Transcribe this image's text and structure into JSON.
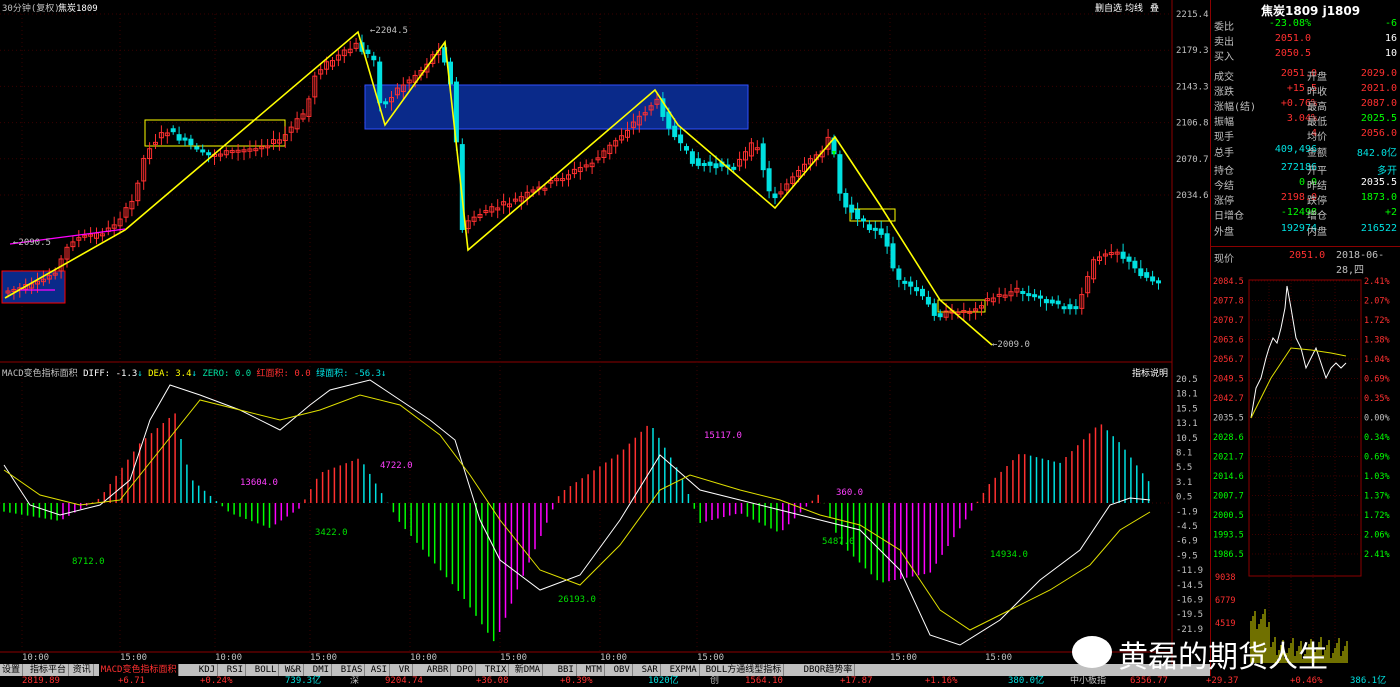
{
  "chart_header": {
    "period": "30分钟(复权)",
    "symbol": "焦炭1809"
  },
  "top_right_controls": [
    "删自选",
    "均线",
    "叠"
  ],
  "price_axis": [
    "2215.4",
    "2179.3",
    "2143.3",
    "2106.8",
    "2070.7",
    "2034.6"
  ],
  "price_annotations": {
    "high": "2204.5",
    "left": "2090.5",
    "low": "2009.0"
  },
  "macd_header": {
    "name": "MACD变色指标面积",
    "diff": "DIFF: -1.3",
    "dea": "DEA: 3.4",
    "zero": "ZERO: 0.0",
    "red_area": "红面积: 0.0",
    "green_area": "绿面积: -56.3",
    "help": "指标说明"
  },
  "macd_axis": [
    "20.5",
    "18.1",
    "15.5",
    "13.1",
    "10.5",
    "8.1",
    "5.5",
    "3.1",
    "0.5",
    "-1.9",
    "-4.5",
    "-6.9",
    "-9.5",
    "-11.9",
    "-14.5",
    "-16.9",
    "-19.5",
    "-21.9"
  ],
  "macd_area_labels": [
    "8712.0",
    "13604.0",
    "3422.0",
    "4722.0",
    "26193.0",
    "15117.0",
    "360.0",
    "5487.0",
    "14934.0"
  ],
  "time_labels": [
    "10:00",
    "15:00",
    "10:00",
    "15:00",
    "10:00",
    "15:00",
    "10:00",
    "15:00",
    "15:00",
    "15:00"
  ],
  "tabs": [
    "设置",
    "指标平台",
    "资讯",
    "MACD变色指标面积",
    "KDJ",
    "RSI",
    "BOLL",
    "W&R",
    "DMI",
    "BIAS",
    "ASI",
    "VR",
    "ARBR",
    "DPO",
    "TRIX",
    "新DMA",
    "BBI",
    "MTM",
    "OBV",
    "SAR",
    "EXPMA",
    "BOLL方通线型指标",
    "DBQR趋势率"
  ],
  "active_tab": "MACD变色指标面积",
  "quote": {
    "title": "焦炭1809 j1809",
    "rows": [
      {
        "l": "委比",
        "v1": "-23.08%",
        "v2": "-6"
      },
      {
        "l": "卖出",
        "v1": "2051.0",
        "v2": "16"
      },
      {
        "l": "买入",
        "v1": "2050.5",
        "v2": "10"
      },
      {
        "l": "成交",
        "v1": "2051.0",
        "m": "开盘",
        "v2": "2029.0"
      },
      {
        "l": "涨跌",
        "v1": "+15.5",
        "m": "昨收",
        "v2": "2021.0"
      },
      {
        "l": "涨幅(结)",
        "v1": "+0.76%",
        "m": "最高",
        "v2": "2087.0"
      },
      {
        "l": "振幅",
        "v1": "3.04%",
        "m": "最低",
        "v2": "2025.5"
      },
      {
        "l": "现手",
        "v1": "4",
        "m": "均价",
        "v2": "2056.0"
      },
      {
        "l": "总手",
        "v1": "409,496",
        "m": "金额",
        "v2": "842.0亿"
      },
      {
        "l": "持仓",
        "v1": "272186",
        "m": "开平",
        "v2": "多开"
      },
      {
        "l": "今结",
        "v1": "0.0",
        "m": "昨结",
        "v2": "2035.5"
      },
      {
        "l": "涨停",
        "v1": "2198.0",
        "m": "跌停",
        "v2": "1873.0"
      },
      {
        "l": "日增仓",
        "v1": "-12498",
        "m": "增仓",
        "v2": "+2"
      },
      {
        "l": "外盘",
        "v1": "192974",
        "m": "内盘",
        "v2": "216522"
      }
    ],
    "spot_label": "现价",
    "spot": "2051.0",
    "date": "2018-06-28,四"
  },
  "mini_left_axis": [
    "2084.5",
    "2077.8",
    "2070.7",
    "2063.6",
    "2056.7",
    "2049.5",
    "2042.7",
    "2035.5",
    "2028.6",
    "2021.7",
    "2014.6",
    "2007.7",
    "2000.5",
    "1993.5",
    "1986.5"
  ],
  "mini_right_axis": [
    "2.41%",
    "2.07%",
    "1.72%",
    "1.38%",
    "1.04%",
    "0.69%",
    "0.35%",
    "0.00%",
    "0.34%",
    "0.69%",
    "1.03%",
    "1.37%",
    "1.72%",
    "2.06%",
    "2.41%"
  ],
  "mini_vol_axis": [
    "9038",
    "6779",
    "4519"
  ],
  "status_bar": [
    "2819.89",
    "+6.71",
    "+0.24%",
    "739.3亿",
    "深",
    "9204.74",
    "+36.08",
    "+0.39%",
    "1020亿",
    "创",
    "1564.10",
    "+17.87",
    "+1.16%",
    "380.0亿",
    "中小板指",
    "6356.77",
    "+29.37",
    "+0.46%",
    "386.1亿"
  ],
  "watermark": "黄磊的期货人生",
  "colors": {
    "up": "#ff3030",
    "down": "#00e0e0",
    "frame": "#8b0000",
    "trend": "#ffff00",
    "box": "#0a2a8a",
    "purple": "#ff00ff"
  }
}
